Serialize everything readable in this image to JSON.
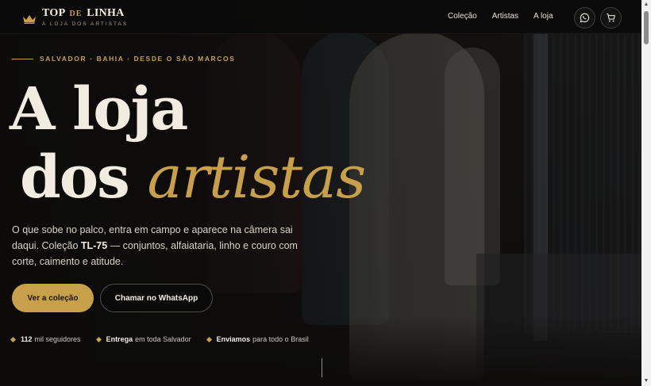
{
  "brand": {
    "title_a": "TOP",
    "title_de": "DE",
    "title_b": "LINHA",
    "subtitle": "A LOJA DOS ARTISTAS",
    "accent_color": "#c9a04a"
  },
  "nav": {
    "items": [
      "Coleção",
      "Artistas",
      "A loja"
    ],
    "whatsapp_icon": "whatsapp-icon",
    "cart_icon": "cart-icon"
  },
  "hero": {
    "eyebrow": "SALVADOR · BAHIA · DESDE O SÃO MARCOS",
    "headline_line1": "A loja",
    "headline_line2_plain": "dos",
    "headline_line2_accent": "artistas",
    "lede_part1": "O que sobe no palco, entra em campo e aparece na câmera sai daqui. Coleção ",
    "lede_bold": "TL-75",
    "lede_part2": " — conjuntos, alfaiataria, linho e couro com corte, caimento e atitude.",
    "primary_cta": "Ver a coleção",
    "secondary_cta": "Chamar no WhatsApp"
  },
  "facts": [
    {
      "bold": "112",
      "text": "mil seguidores"
    },
    {
      "bold": "Entrega",
      "text": "em toda Salvador"
    },
    {
      "bold": "Enviamos",
      "text": "para todo o Brasil"
    }
  ]
}
